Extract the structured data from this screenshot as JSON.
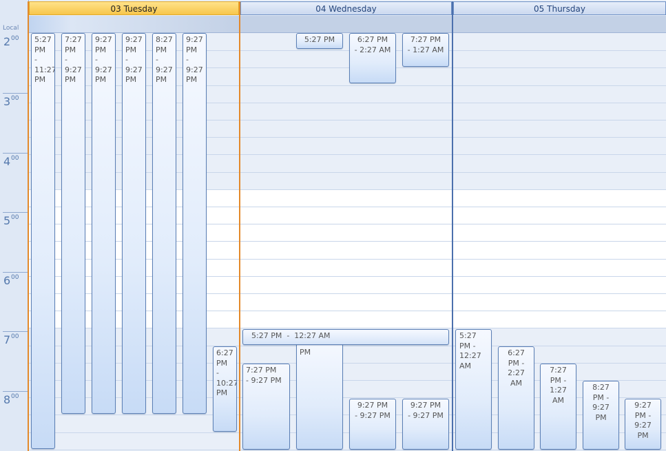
{
  "ruler": {
    "label": "Local",
    "hours": [
      {
        "hour": "2",
        "min": "00"
      },
      {
        "hour": "3",
        "min": "00"
      },
      {
        "hour": "4",
        "min": "00"
      },
      {
        "hour": "5",
        "min": "00"
      },
      {
        "hour": "6",
        "min": "00"
      },
      {
        "hour": "7",
        "min": "00"
      },
      {
        "hour": "8",
        "min": "00"
      }
    ]
  },
  "days": [
    {
      "label": "03 Tuesday",
      "today": true
    },
    {
      "label": "04 Wednesday",
      "today": false
    },
    {
      "label": "05 Thursday",
      "today": false
    }
  ],
  "appointments": {
    "tue": [
      {
        "text": "5:27\nPM\n-\n11:27\nPM"
      },
      {
        "text": "7:27\nPM\n-\n9:27\nPM"
      },
      {
        "text": "9:27\nPM\n-\n9:27\nPM"
      },
      {
        "text": "9:27\nPM\n-\n9:27\nPM"
      },
      {
        "text": "8:27\nPM\n-\n9:27\nPM"
      },
      {
        "text": "9:27\nPM\n-\n9:27\nPM"
      },
      {
        "text": "6:27\nPM\n-\n10:27\nPM"
      }
    ],
    "wed": [
      {
        "text": "5:27 PM"
      },
      {
        "text": "6:27 PM\n- 2:27 AM"
      },
      {
        "text": "7:27 PM\n- 1:27 AM"
      },
      {
        "text": "5:27 PM  -  12:27 AM"
      },
      {
        "text": "7:27 PM\n- 9:27 PM"
      },
      {
        "text": "- 11:27 PM"
      },
      {
        "text": "9:27 PM\n- 9:27 PM"
      },
      {
        "text": "9:27 PM\n- 9:27 PM"
      }
    ],
    "thu": [
      {
        "text": "5:27\nPM -\n12:27\nAM"
      },
      {
        "text": "6:27\nPM -\n2:27 AM"
      },
      {
        "text": "7:27\nPM -\n1:27 AM"
      },
      {
        "text": "8:27\nPM -\n9:27 PM"
      },
      {
        "text": "9:27\nPM -\n9:27 PM"
      }
    ]
  }
}
